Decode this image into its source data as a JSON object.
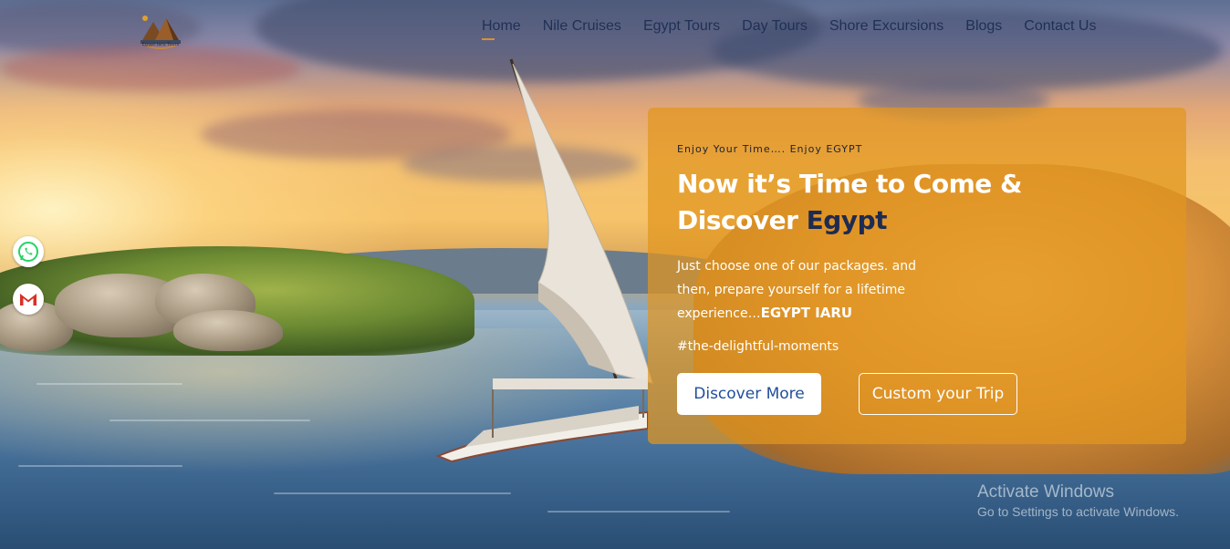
{
  "brand": {
    "logo_text": "Egypt Iaru Tours",
    "accent_color": "#d9922e",
    "nav_text_color": "#1f3055"
  },
  "nav": {
    "items": [
      {
        "label": "Home",
        "active": true
      },
      {
        "label": "Nile Cruises"
      },
      {
        "label": "Egypt Tours"
      },
      {
        "label": "Day Tours"
      },
      {
        "label": "Shore Excursions"
      },
      {
        "label": "Blogs"
      },
      {
        "label": "Contact Us"
      }
    ]
  },
  "social": {
    "whatsapp_icon": "whatsapp-icon",
    "gmail_icon": "gmail-icon"
  },
  "hero": {
    "tagline": "Enjoy Your Time…. Enjoy EGYPT",
    "headline_part1": "Now it’s Time to Come &",
    "headline_part2": "Discover ",
    "headline_accent": "Egypt",
    "description": "Just choose one of our packages. and then, prepare yourself for a lifetime experience…",
    "description_strong": "EGYPT IARU",
    "hashtag": "#the-delightful-moments",
    "primary_button": "Discover More",
    "secondary_button": "Custom your Trip",
    "card_color": "#e2961e"
  },
  "watermark": {
    "title": "Activate Windows",
    "subtitle": "Go to Settings to activate Windows."
  }
}
